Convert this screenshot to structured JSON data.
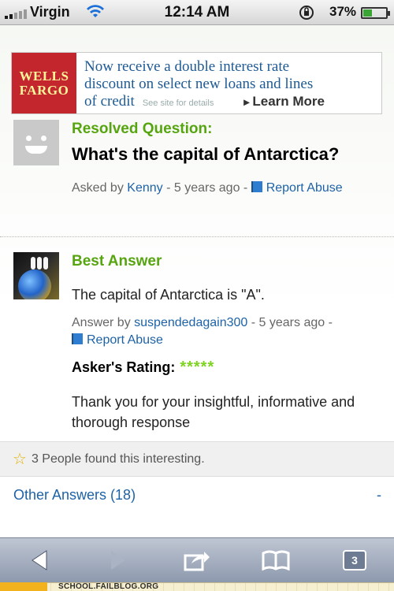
{
  "status": {
    "carrier": "Virgin",
    "time": "12:14 AM",
    "battery_pct": "37%",
    "battery_level": 0.37
  },
  "ad": {
    "logo_line1": "WELLS",
    "logo_line2": "FARGO",
    "line1": "Now receive a double interest rate",
    "line2": "discount on select new loans and lines",
    "line3": "of credit",
    "small": "See site for details",
    "cta": "Learn More"
  },
  "question": {
    "label": "Resolved Question:",
    "title": "What's the capital of Antarctica?",
    "asked_prefix": "Asked by",
    "asker": "Kenny",
    "age": "- 5 years ago -",
    "report": "Report Abuse"
  },
  "best": {
    "label": "Best Answer",
    "text": "The capital of Antarctica is \"A\".",
    "by_prefix": "Answer by",
    "answerer": "suspendedagain300",
    "age": "- 5 years ago -",
    "report": "Report Abuse",
    "rating_label": "Asker's Rating:",
    "rating_stars": "*****",
    "rating_value": 5,
    "comment": "Thank you for your insightful, informative and thorough response"
  },
  "interesting": "3 People found this interesting.",
  "other_answers": "Other Answers (18)",
  "other_toggle": "-",
  "toolbar": {
    "tab_count": "3"
  },
  "watermark": "SCHOOL.FAILBLOG.ORG",
  "colors": {
    "green": "#56a510",
    "link": "#1d62a7",
    "wf_red": "#c4262e"
  }
}
